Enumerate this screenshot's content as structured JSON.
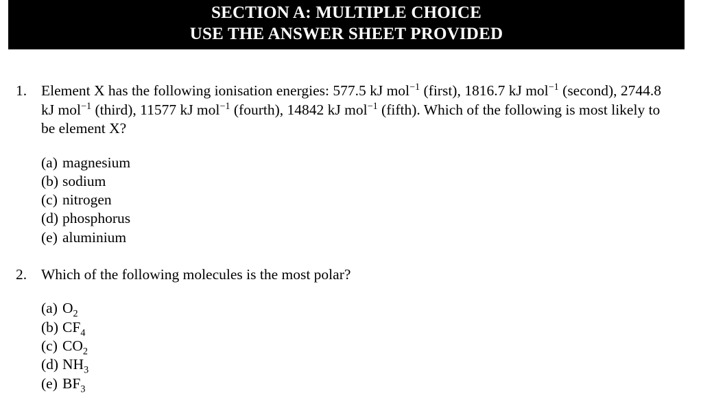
{
  "header": {
    "line1": "SECTION A: MULTIPLE CHOICE",
    "line2": "USE THE ANSWER SHEET PROVIDED",
    "background_color": "#000000",
    "text_color": "#ffffff"
  },
  "questions": [
    {
      "number": "1.",
      "text_segments": [
        {
          "type": "text",
          "value": "Element X has the following ionisation energies: 577.5 kJ mol"
        },
        {
          "type": "sup",
          "value": "−1"
        },
        {
          "type": "text",
          "value": " (first), 1816.7 kJ mol"
        },
        {
          "type": "sup",
          "value": "−1"
        },
        {
          "type": "text",
          "value": " (second), 2744.8 kJ mol"
        },
        {
          "type": "sup",
          "value": "−1"
        },
        {
          "type": "text",
          "value": " (third), 11577 kJ mol"
        },
        {
          "type": "sup",
          "value": "−1"
        },
        {
          "type": "text",
          "value": " (fourth), 14842 kJ mol"
        },
        {
          "type": "sup",
          "value": "−1"
        },
        {
          "type": "text",
          "value": " (fifth). Which of the following is most likely to be element X?"
        }
      ],
      "plain_text": "Element X has the following ionisation energies: 577.5 kJ mol−1 (first), 1816.7 kJ mol−1 (second), 2744.8 kJ mol−1 (third), 11577 kJ mol−1 (fourth), 14842 kJ mol−1 (fifth). Which of the following is most likely to be element X?",
      "options": [
        {
          "letter": "(a)",
          "label": "magnesium"
        },
        {
          "letter": "(b)",
          "label": "sodium"
        },
        {
          "letter": "(c)",
          "label": "nitrogen"
        },
        {
          "letter": "(d)",
          "label": "phosphorus"
        },
        {
          "letter": "(e)",
          "label": "aluminium"
        }
      ]
    },
    {
      "number": "2.",
      "text_segments": [
        {
          "type": "text",
          "value": "Which of the following molecules is the most polar?"
        }
      ],
      "plain_text": "Which of the following molecules is the most polar?",
      "options": [
        {
          "letter": "(a)",
          "formula_base": "O",
          "formula_sub": "2"
        },
        {
          "letter": "(b)",
          "formula_base": "CF",
          "formula_sub": "4"
        },
        {
          "letter": "(c)",
          "formula_base": "CO",
          "formula_sub": "2"
        },
        {
          "letter": "(d)",
          "formula_base": "NH",
          "formula_sub": "3"
        },
        {
          "letter": "(e)",
          "formula_base": "BF",
          "formula_sub": "3"
        }
      ]
    }
  ]
}
